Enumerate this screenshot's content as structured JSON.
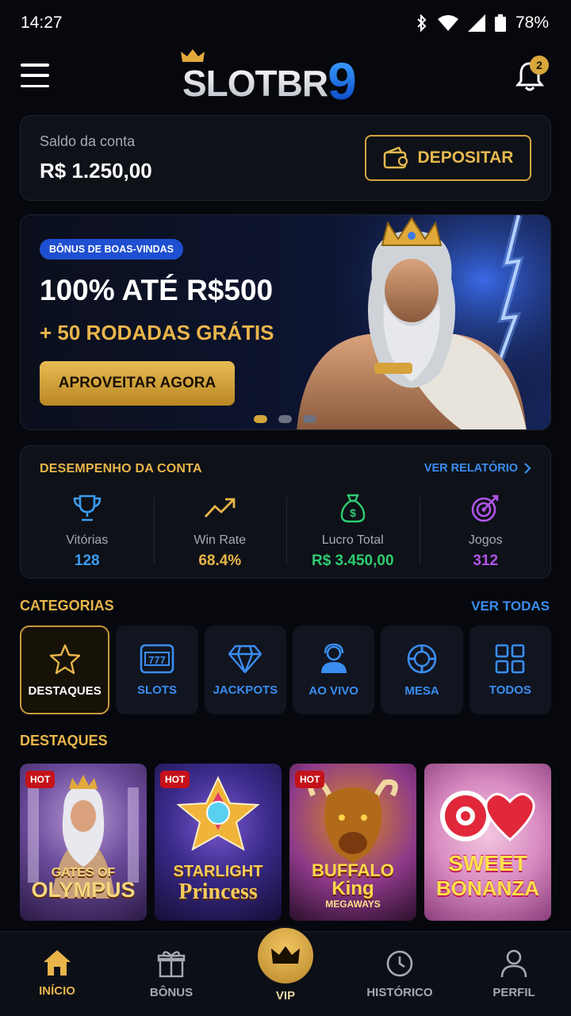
{
  "status_bar": {
    "time": "14:27",
    "battery": "78%"
  },
  "header": {
    "logo_text": "SLOTBR",
    "logo_number": "9",
    "notification_count": "2"
  },
  "balance": {
    "label": "Saldo da conta",
    "value": "R$ 1.250,00",
    "deposit_label": "DEPOSITAR"
  },
  "banner": {
    "tag": "BÔNUS DE BOAS-VINDAS",
    "title": "100% ATÉ R$500",
    "subtitle": "+ 50 RODADAS GRÁTIS",
    "cta": "APROVEITAR AGORA",
    "slide_count": 3,
    "active_slide": 1
  },
  "performance": {
    "title": "DESEMPENHO DA CONTA",
    "link": "VER RELATÓRIO",
    "stats": [
      {
        "icon": "trophy-icon",
        "label": "Vitórias",
        "value": "128",
        "color": "#3a9bf0"
      },
      {
        "icon": "trending-up-icon",
        "label": "Win Rate",
        "value": "68.4%",
        "color": "#e9b54a"
      },
      {
        "icon": "money-bag-icon",
        "label": "Lucro Total",
        "value": "R$ 3.450,00",
        "color": "#2ecc71"
      },
      {
        "icon": "target-icon",
        "label": "Jogos",
        "value": "312",
        "color": "#b054e8"
      }
    ]
  },
  "categories": {
    "title": "CATEGORIAS",
    "link": "VER TODAS",
    "items": [
      {
        "icon": "star-icon",
        "label": "DESTAQUES",
        "active": true
      },
      {
        "icon": "slot-machine-icon",
        "label": "SLOTS"
      },
      {
        "icon": "diamond-icon",
        "label": "JACKPOTS"
      },
      {
        "icon": "live-dealer-icon",
        "label": "AO VIVO"
      },
      {
        "icon": "poker-chip-icon",
        "label": "MESA"
      },
      {
        "icon": "grid-icon",
        "label": "TODOS"
      }
    ]
  },
  "featured": {
    "title": "DESTAQUES",
    "games": [
      {
        "line1": "GATES OF",
        "line2": "OLYMPUS",
        "badge": "HOT"
      },
      {
        "line1": "STARLIGHT",
        "line2": "Princess",
        "badge": "HOT"
      },
      {
        "line1": "BUFFALO",
        "line2": "King",
        "line3": "MEGAWAYS",
        "badge": "HOT"
      },
      {
        "line1": "SWEET",
        "line2": "BONANZA"
      }
    ]
  },
  "nav": {
    "items": [
      {
        "label": "INÍCIO",
        "icon": "home-icon",
        "active": true
      },
      {
        "label": "BÔNUS",
        "icon": "gift-icon"
      },
      {
        "label": "VIP",
        "icon": "crown-icon"
      },
      {
        "label": "HISTÓRICO",
        "icon": "clock-icon"
      },
      {
        "label": "PERFIL",
        "icon": "user-icon"
      }
    ]
  }
}
